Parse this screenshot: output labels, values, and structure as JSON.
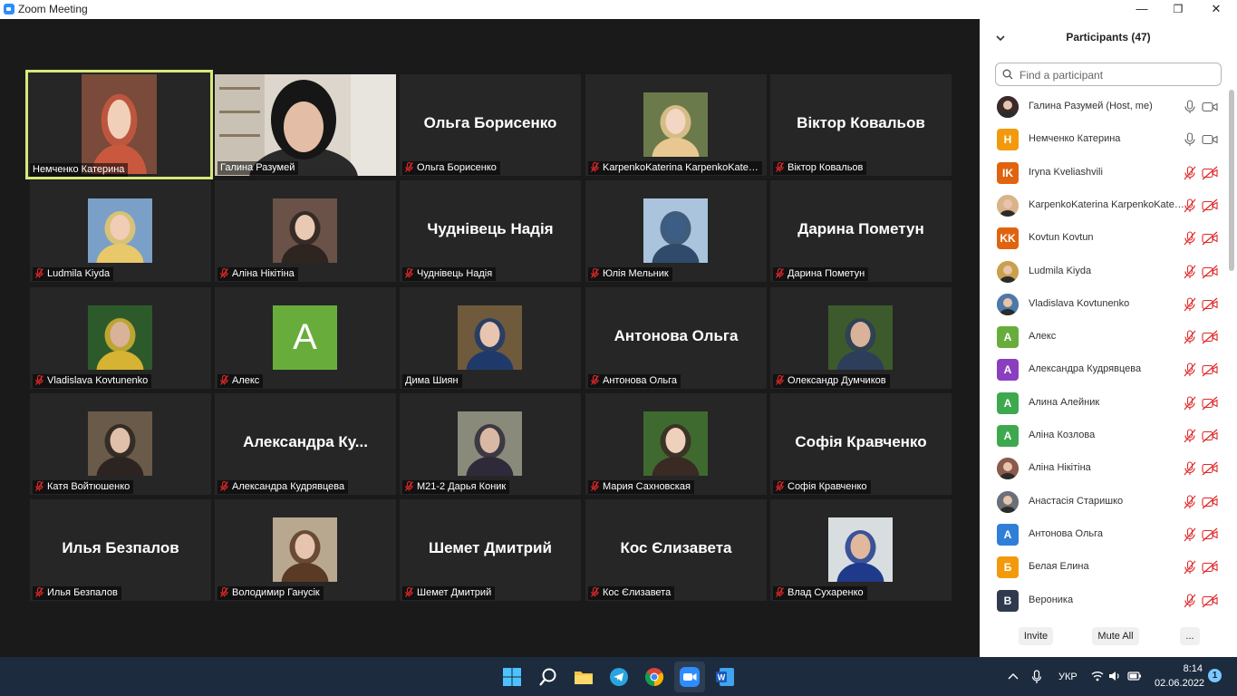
{
  "window": {
    "title": "Zoom Meeting",
    "minimize": "—",
    "restore": "❐",
    "close": "✕"
  },
  "tiles": [
    {
      "label": "Немченко Катерина",
      "big": "",
      "muted": false
    },
    {
      "label": "Галина Разумей",
      "big": "",
      "muted": false
    },
    {
      "label": "Ольга Борисенко",
      "big": "Ольга Борисенко",
      "muted": true
    },
    {
      "label": "KarpenkoKaterina KarpenkoKateri...",
      "big": "",
      "muted": true
    },
    {
      "label": "Віктор Ковальов",
      "big": "Віктор Ковальов",
      "muted": true
    },
    {
      "label": "Ludmila Kiyda",
      "big": "",
      "muted": true
    },
    {
      "label": "Аліна Нікітіна",
      "big": "",
      "muted": true
    },
    {
      "label": "Чуднівець Надія",
      "big": "Чуднівець Надія",
      "muted": true
    },
    {
      "label": "Юлія Мельник",
      "big": "",
      "muted": true
    },
    {
      "label": "Дарина Пометун",
      "big": "Дарина Пометун",
      "muted": true
    },
    {
      "label": "Vladislava Kovtunenko",
      "big": "",
      "muted": true
    },
    {
      "label": "Алекс",
      "big": "",
      "muted": true,
      "avatar_letter": "A"
    },
    {
      "label": "Дима Шиян",
      "big": "",
      "muted": false
    },
    {
      "label": "Антонова Ольга",
      "big": "Антонова Ольга",
      "muted": true
    },
    {
      "label": "Олександр Думчиков",
      "big": "",
      "muted": true
    },
    {
      "label": "Катя Войтюшенко",
      "big": "",
      "muted": true
    },
    {
      "label": "Александра Кудрявцева",
      "big": "Александра  Ку...",
      "muted": true
    },
    {
      "label": "М21-2 Дарья Коник",
      "big": "",
      "muted": true
    },
    {
      "label": "Мария Сахновская",
      "big": "",
      "muted": true
    },
    {
      "label": "Софія Кравченко",
      "big": "Софія Кравченко",
      "muted": true
    },
    {
      "label": "Илья Безпалов",
      "big": "Илья Безпалов",
      "muted": true
    },
    {
      "label": "Володимир Ганусік",
      "big": "",
      "muted": true
    },
    {
      "label": "Шемет Дмитрий",
      "big": "Шемет Дмитрий",
      "muted": true
    },
    {
      "label": "Кос  Єлизавета",
      "big": "Кос  Єлизавета",
      "muted": true
    },
    {
      "label": "Влад Сухаренко",
      "big": "",
      "muted": true
    }
  ],
  "panel": {
    "title": "Participants (47)",
    "search_placeholder": "Find a participant",
    "participants": [
      {
        "name": "Галина Разумей (Host, me)",
        "initials": "",
        "color": "#3b2a2a",
        "muted": false
      },
      {
        "name": "Немченко Катерина",
        "initials": "Н",
        "color": "#f29a0c",
        "muted": false
      },
      {
        "name": "Iryna Kveliashvili",
        "initials": "IK",
        "color": "#e0640f",
        "muted": true
      },
      {
        "name": "KarpenkoKaterina KarpenkoKater...",
        "initials": "",
        "color": "#d9b38a",
        "muted": true
      },
      {
        "name": "Kovtun Kovtun",
        "initials": "KK",
        "color": "#e0640f",
        "muted": true
      },
      {
        "name": "Ludmila Kiyda",
        "initials": "",
        "color": "#c9a04d",
        "muted": true
      },
      {
        "name": "Vladislava Kovtunenko",
        "initials": "",
        "color": "#4d79a8",
        "muted": true
      },
      {
        "name": "Алекс",
        "initials": "A",
        "color": "#68ad3c",
        "muted": true
      },
      {
        "name": "Александра Кудрявцева",
        "initials": "A",
        "color": "#8b3fbf",
        "muted": true
      },
      {
        "name": "Алина Алейник",
        "initials": "A",
        "color": "#3ea84e",
        "muted": true
      },
      {
        "name": "Аліна Козлова",
        "initials": "A",
        "color": "#3ea84e",
        "muted": true
      },
      {
        "name": "Аліна Нікітіна",
        "initials": "",
        "color": "#8a5b4c",
        "muted": true
      },
      {
        "name": "Анастасія Старишко",
        "initials": "",
        "color": "#6a7078",
        "muted": true
      },
      {
        "name": "Антонова Ольга",
        "initials": "A",
        "color": "#2f7fd8",
        "muted": true
      },
      {
        "name": "Белая Елина",
        "initials": "Б",
        "color": "#f29a0c",
        "muted": true
      },
      {
        "name": "Вероника",
        "initials": "В",
        "color": "#2f3a4f",
        "muted": true
      }
    ],
    "invite_label": "Invite",
    "mute_all_label": "Mute All",
    "more_label": "..."
  },
  "taskbar": {
    "language": "УКР",
    "time": "8:14",
    "date": "02.06.2022",
    "notifications": "1"
  },
  "colors": {
    "stage_bg": "#1a1a1a",
    "tile_bg": "#262626",
    "active_speaker": "#d8e87a",
    "muted_red": "#e02828",
    "taskbar": "#1c2b3e"
  }
}
